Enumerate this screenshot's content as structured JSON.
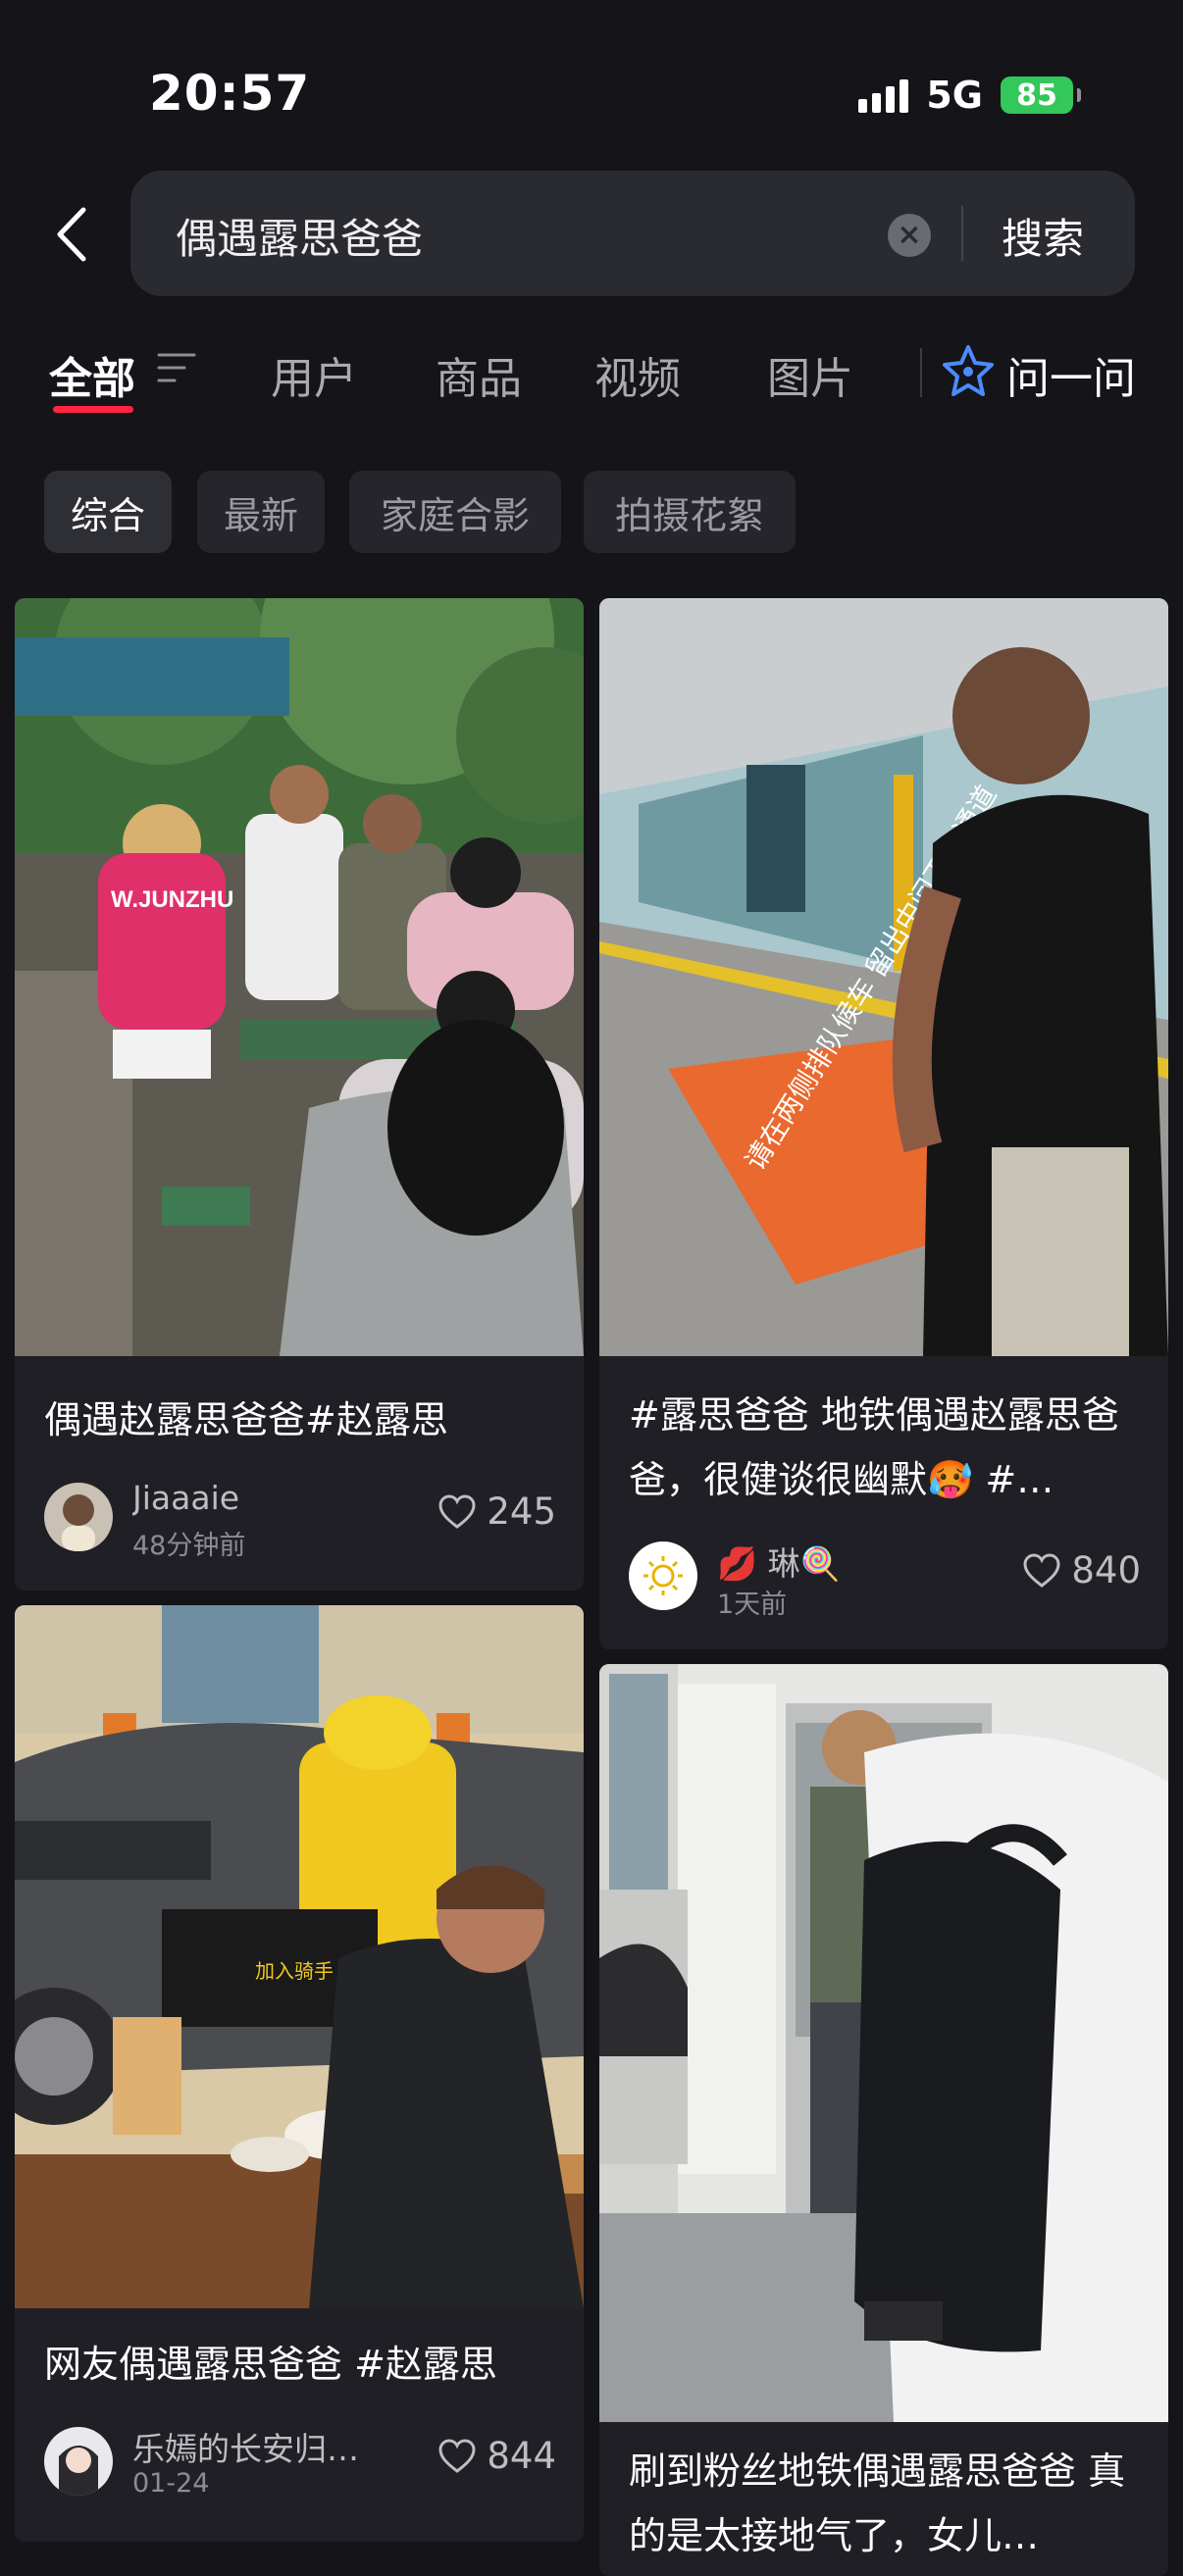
{
  "status_bar": {
    "time": "20:57",
    "network": "5G",
    "battery": "85"
  },
  "search": {
    "query": "偶遇露思爸爸",
    "button_label": "搜索"
  },
  "tabs": [
    {
      "label": "全部",
      "active": true
    },
    {
      "label": "用户",
      "active": false
    },
    {
      "label": "商品",
      "active": false
    },
    {
      "label": "视频",
      "active": false
    },
    {
      "label": "图片",
      "active": false
    }
  ],
  "ask": {
    "label": "问一问"
  },
  "filter_chips": [
    {
      "label": "综合",
      "active": true
    },
    {
      "label": "最新",
      "active": false
    },
    {
      "label": "家庭合影",
      "active": false
    },
    {
      "label": "拍摄花絮",
      "active": false
    }
  ],
  "posts": [
    {
      "title": "偶遇赵露思爸爸#赵露思",
      "author": "Jiaaaie",
      "time": "48分钟前",
      "likes": "245",
      "image_caption": "W.JUNZHU"
    },
    {
      "title": "#露思爸爸 地铁偶遇赵露思爸爸，很健谈很幽默🥵 #…",
      "author": "💋 琳🍭",
      "time": "1天前",
      "likes": "840",
      "image_caption": "请在两侧排队候车 留出中间下车通道"
    },
    {
      "title": "网友偶遇露思爸爸 #赵露思",
      "author": "乐嫣的长安归…",
      "time": "01-24",
      "likes": "844",
      "image_caption": "加入骑手"
    },
    {
      "title": "刷到粉丝地铁偶遇露思爸爸 真的是太接地气了，女儿…",
      "author": "",
      "time": "",
      "likes": ""
    }
  ],
  "colors": {
    "background": "#141419",
    "card": "#1f1f25",
    "accent": "#ff2442",
    "ask_icon": "#4a8cff"
  },
  "icons": [
    "back-arrow-icon",
    "clear-icon",
    "filter-icon",
    "ask-star-icon",
    "heart-icon",
    "sun-icon"
  ]
}
